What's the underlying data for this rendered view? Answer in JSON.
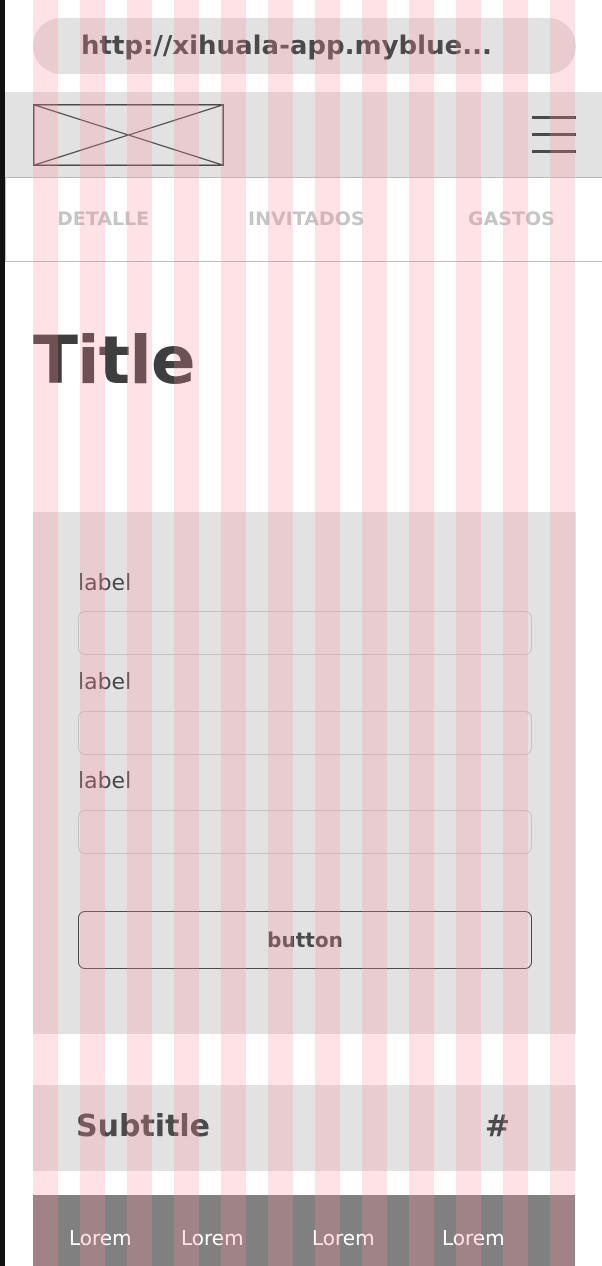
{
  "browser": {
    "url": "http://xihuala-app.myblue..."
  },
  "header": {
    "logo_icon": "image-placeholder-icon",
    "menu_icon": "hamburger-menu-icon"
  },
  "tabs": [
    {
      "label": "DETALLE"
    },
    {
      "label": "INVITADOS"
    },
    {
      "label": "GASTOS"
    }
  ],
  "page": {
    "title": "Title"
  },
  "form": {
    "fields": [
      {
        "label": "label",
        "value": "",
        "placeholder": ""
      },
      {
        "label": "label",
        "value": "",
        "placeholder": ""
      },
      {
        "label": "label",
        "value": "",
        "placeholder": ""
      }
    ],
    "button_label": "button"
  },
  "summary": {
    "subtitle": "Subtitle",
    "count": "#"
  },
  "bottom_nav": {
    "items": [
      {
        "label": "Lorem"
      },
      {
        "label": "Lorem"
      },
      {
        "label": "Lorem"
      },
      {
        "label": "Lorem"
      }
    ]
  },
  "colors": {
    "wire_fill": "#e2e2e2",
    "text_dark": "#4a4a4a",
    "nav_fill": "#808080",
    "grid_overlay": "#ffe0e3"
  }
}
